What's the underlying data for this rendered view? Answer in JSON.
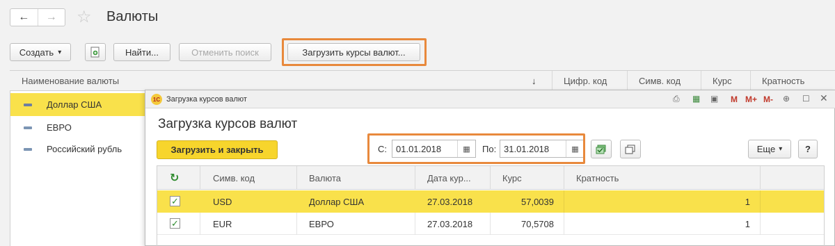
{
  "window": {
    "title": "Валюты",
    "back_icon": "←",
    "forward_icon": "→",
    "star_icon": "☆"
  },
  "toolbar": {
    "create_label": "Создать",
    "create_arrow": "▾",
    "find_label": "Найти...",
    "cancel_search_label": "Отменить поиск",
    "load_rates_label": "Загрузить курсы валют..."
  },
  "currency_list": {
    "columns": [
      "Наименование валюты",
      "↓",
      "Цифр. код",
      "Симв. код",
      "Курс",
      "Кратность"
    ],
    "items": [
      {
        "name": "Доллар США",
        "selected": true
      },
      {
        "name": "ЕВРО",
        "selected": false
      },
      {
        "name": "Российский рубль",
        "selected": false
      }
    ]
  },
  "dialog": {
    "window_caption": "Загрузка курсов валют",
    "logo_text": "1С",
    "heading": "Загрузка курсов валют",
    "load_close_label": "Загрузить и закрыть",
    "from_label": "С:",
    "from_value": "01.01.2018",
    "to_label": "По:",
    "to_value": "31.01.2018",
    "more_label": "Еще",
    "more_arrow": "▾",
    "help_label": "?",
    "titlebar_m": "M",
    "titlebar_mplus": "M+",
    "titlebar_mminus": "M-",
    "grid": {
      "columns": [
        "Симв. код",
        "Валюта",
        "Дата кур...",
        "Курс",
        "Кратность"
      ],
      "rows": [
        {
          "checked": true,
          "code": "USD",
          "currency": "Доллар США",
          "date": "27.03.2018",
          "rate": "57,0039",
          "multiplicity": "1",
          "selected": true
        },
        {
          "checked": true,
          "code": "EUR",
          "currency": "ЕВРО",
          "date": "27.03.2018",
          "rate": "70,5708",
          "multiplicity": "1",
          "selected": false
        }
      ]
    }
  },
  "colors": {
    "highlight_orange": "#e8893c",
    "selection_yellow": "#f9e14b",
    "primary_button_yellow": "#f7d52c"
  }
}
